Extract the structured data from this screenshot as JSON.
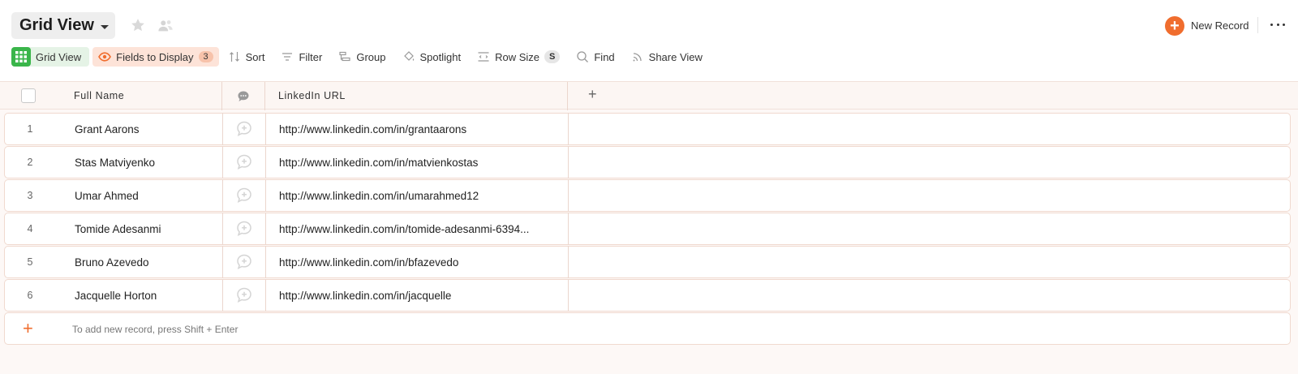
{
  "header": {
    "view_title": "Grid View",
    "new_record_label": "New Record"
  },
  "toolbar": {
    "grid_view_label": "Grid View",
    "fields_label": "Fields to Display",
    "fields_count": "3",
    "sort_label": "Sort",
    "filter_label": "Filter",
    "group_label": "Group",
    "spotlight_label": "Spotlight",
    "row_size_label": "Row Size",
    "row_size_value": "S",
    "find_label": "Find",
    "share_label": "Share View"
  },
  "columns": {
    "name": "Full Name",
    "url": "LinkedIn URL"
  },
  "rows": [
    {
      "num": "1",
      "name": "Grant Aarons",
      "url": "http://www.linkedin.com/in/grantaarons"
    },
    {
      "num": "2",
      "name": "Stas Matviyenko",
      "url": "http://www.linkedin.com/in/matvienkostas"
    },
    {
      "num": "3",
      "name": "Umar Ahmed",
      "url": "http://www.linkedin.com/in/umarahmed12"
    },
    {
      "num": "4",
      "name": "Tomide Adesanmi",
      "url": "http://www.linkedin.com/in/tomide-adesanmi-6394..."
    },
    {
      "num": "5",
      "name": "Bruno Azevedo",
      "url": "http://www.linkedin.com/in/bfazevedo"
    },
    {
      "num": "6",
      "name": "Jacquelle Horton",
      "url": "http://www.linkedin.com/in/jacquelle"
    }
  ],
  "add_row_hint": "To add new record, press Shift + Enter",
  "colors": {
    "accent": "#f06d2e",
    "grid_green": "#3ab54a",
    "row_border": "#f0d9cf"
  }
}
